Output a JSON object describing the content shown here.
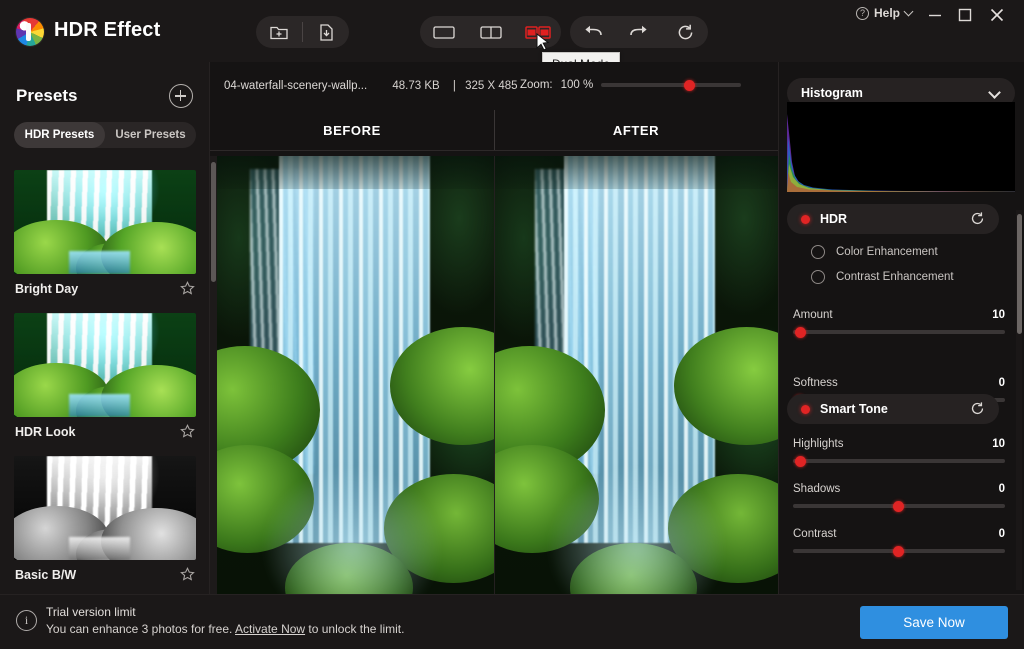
{
  "app": {
    "title": "HDR Effect",
    "logo_icon": "colorwheel-logo-icon"
  },
  "titlebar": {
    "file_tools": [
      {
        "name": "open-image-button",
        "icon": "folder-add-icon"
      },
      {
        "name": "save-image-button",
        "icon": "file-download-icon"
      }
    ],
    "view_modes": [
      {
        "name": "single-mode-button",
        "icon": "single-view-icon",
        "active": false
      },
      {
        "name": "split-mode-button",
        "icon": "split-view-icon",
        "active": false
      },
      {
        "name": "dual-mode-button",
        "icon": "dual-view-icon",
        "active": true
      }
    ],
    "history_tools": [
      {
        "name": "undo-button",
        "icon": "undo-arrow-icon"
      },
      {
        "name": "redo-button",
        "icon": "redo-arrow-icon"
      },
      {
        "name": "reset-button",
        "icon": "refresh-circle-icon"
      }
    ],
    "tooltip": "Dual Mode",
    "help_label": "Help",
    "help_icon": "question-circle-icon",
    "window_controls": [
      {
        "name": "minimize-button",
        "icon": "minimize-icon"
      },
      {
        "name": "maximize-button",
        "icon": "maximize-icon"
      },
      {
        "name": "close-button",
        "icon": "close-x-icon"
      }
    ]
  },
  "sidebar": {
    "title": "Presets",
    "add_icon": "plus-circle-icon",
    "tabs": [
      {
        "label": "HDR Presets",
        "active": true
      },
      {
        "label": "User Presets",
        "active": false
      }
    ],
    "presets": [
      {
        "label": "Bright Day",
        "style": "vivid",
        "favorite_icon": "star-outline-icon"
      },
      {
        "label": "HDR Look",
        "style": "vivid",
        "favorite_icon": "star-outline-icon"
      },
      {
        "label": "Basic B/W",
        "style": "bw",
        "favorite_icon": "star-outline-icon"
      }
    ]
  },
  "center": {
    "file_name": "04-waterfall-scenery-wallp...",
    "file_size": "48.73 KB",
    "file_sep": "|",
    "file_dimensions": "325 X 485",
    "zoom_label": "Zoom:",
    "zoom_value": "100 %",
    "zoom_percent": 59,
    "before_label": "BEFORE",
    "after_label": "AFTER"
  },
  "right": {
    "histogram": {
      "title": "Histogram",
      "chevron_icon": "chevron-down-icon"
    },
    "hdr": {
      "title": "HDR",
      "toggle_icon": "red-toggle-dot-icon",
      "reset_icon": "refresh-circle-icon",
      "radios": [
        {
          "label": "Color Enhancement",
          "selected": false
        },
        {
          "label": "Contrast Enhancement",
          "selected": false
        }
      ],
      "sliders": [
        {
          "label": "Amount",
          "value": "10",
          "percent": 4
        },
        {
          "label": "Softness",
          "value": "0",
          "percent": 1
        }
      ]
    },
    "smart_tone": {
      "title": "Smart Tone",
      "toggle_icon": "red-toggle-dot-icon",
      "reset_icon": "refresh-circle-icon",
      "sliders": [
        {
          "label": "Highlights",
          "value": "10",
          "percent": 4
        },
        {
          "label": "Shadows",
          "value": "0",
          "percent": 50
        },
        {
          "label": "Contrast",
          "value": "0",
          "percent": 50
        }
      ]
    }
  },
  "footer": {
    "info_icon": "info-circle-icon",
    "trial_title": "Trial version limit",
    "trial_text_before": "You can enhance 3 photos for free. ",
    "trial_link": "Activate Now",
    "trial_text_after": " to unlock the limit.",
    "save_label": "Save Now"
  },
  "colors": {
    "accent_red": "#e02424",
    "save_blue": "#2f8fe0",
    "panel_bg": "#1b1818",
    "app_bg": "#151313"
  }
}
